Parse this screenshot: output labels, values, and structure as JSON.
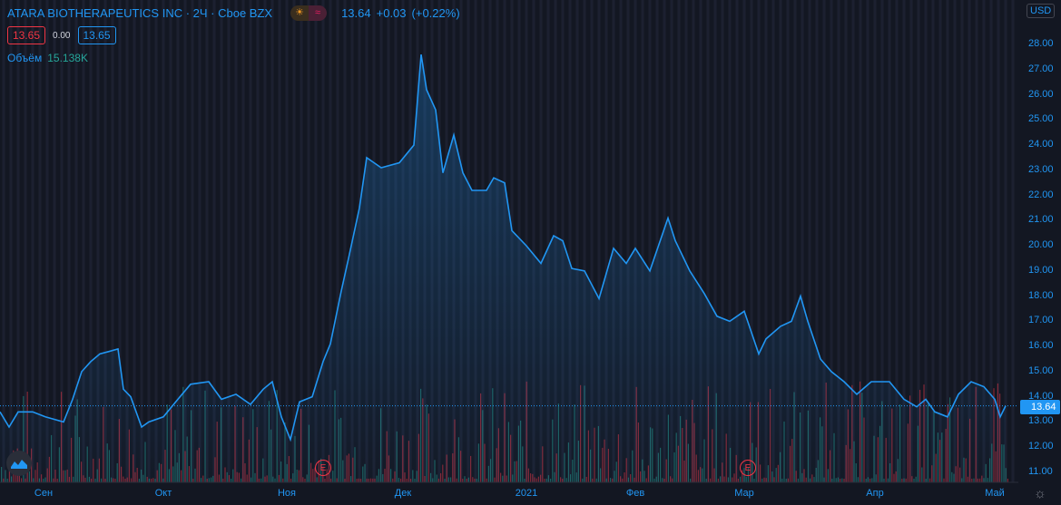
{
  "header": {
    "title": "ATARA BIOTHERAPEUTICS INC · 2Ч · Cboe BZX",
    "last": "13.64",
    "change": "+0.03",
    "change_pct": "(+0.22%)",
    "sun_icon": "sun-icon",
    "wave_icon": "wave-icon"
  },
  "quote": {
    "bid": "13.65",
    "spread": "0.00",
    "ask": "13.65"
  },
  "volume": {
    "label": "Объём",
    "value": "15.138K"
  },
  "currency": "USD",
  "colors": {
    "line": "#2196f3",
    "up": "#26a69a",
    "down": "#f23645",
    "bg": "#131722"
  },
  "earnings_label": "E",
  "chart_data": {
    "type": "area",
    "title": "ATARA BIOTHERAPEUTICS INC · 2Ч · Cboe BZX",
    "ylim": [
      10.5,
      29
    ],
    "y_ticks": [
      "28.00",
      "27.00",
      "26.00",
      "25.00",
      "24.00",
      "23.00",
      "22.00",
      "21.00",
      "20.00",
      "19.00",
      "18.00",
      "17.00",
      "16.00",
      "15.00",
      "14.00",
      "13.00",
      "12.00",
      "11.00"
    ],
    "x_ticks": [
      {
        "label": "Сен",
        "bar": 12
      },
      {
        "label": "Окт",
        "bar": 45
      },
      {
        "label": "Ноя",
        "bar": 79
      },
      {
        "label": "Дек",
        "bar": 111
      },
      {
        "label": "2021",
        "bar": 145
      },
      {
        "label": "Фев",
        "bar": 175
      },
      {
        "label": "Мар",
        "bar": 205
      },
      {
        "label": "Апр",
        "bar": 241
      },
      {
        "label": "Май",
        "bar": 274
      }
    ],
    "earnings_bars": [
      89,
      206
    ],
    "last_price": "13.64",
    "points": [
      [
        0,
        13.4
      ],
      [
        2.5,
        12.8
      ],
      [
        5,
        13.4
      ],
      [
        9,
        13.4
      ],
      [
        12.5,
        13.2
      ],
      [
        17.5,
        13.0
      ],
      [
        20,
        13.9
      ],
      [
        22.5,
        15.0
      ],
      [
        25,
        15.4
      ],
      [
        27.5,
        15.7
      ],
      [
        30,
        15.8
      ],
      [
        32.5,
        15.9
      ],
      [
        34,
        14.3
      ],
      [
        36,
        14.0
      ],
      [
        39,
        12.8
      ],
      [
        41,
        13.0
      ],
      [
        45,
        13.2
      ],
      [
        49,
        13.9
      ],
      [
        52.5,
        14.5
      ],
      [
        57.5,
        14.6
      ],
      [
        61,
        13.9
      ],
      [
        65,
        14.1
      ],
      [
        69,
        13.7
      ],
      [
        72.5,
        14.3
      ],
      [
        75,
        14.6
      ],
      [
        77.5,
        13.2
      ],
      [
        80,
        12.3
      ],
      [
        82.5,
        13.8
      ],
      [
        86,
        14.0
      ],
      [
        89,
        15.4
      ],
      [
        91,
        16.1
      ],
      [
        94,
        18.2
      ],
      [
        96,
        19.5
      ],
      [
        99,
        21.5
      ],
      [
        101,
        23.5
      ],
      [
        105,
        23.1
      ],
      [
        110,
        23.3
      ],
      [
        114,
        24.0
      ],
      [
        116,
        27.6
      ],
      [
        117.5,
        26.2
      ],
      [
        120,
        25.4
      ],
      [
        122,
        22.9
      ],
      [
        125,
        24.4
      ],
      [
        127.5,
        22.9
      ],
      [
        130,
        22.2
      ],
      [
        134,
        22.2
      ],
      [
        136,
        22.7
      ],
      [
        139,
        22.5
      ],
      [
        141,
        20.6
      ],
      [
        145,
        20.0
      ],
      [
        149,
        19.3
      ],
      [
        152.5,
        20.4
      ],
      [
        155,
        20.2
      ],
      [
        157.5,
        19.1
      ],
      [
        161,
        19.0
      ],
      [
        165,
        17.9
      ],
      [
        169,
        19.9
      ],
      [
        172.5,
        19.3
      ],
      [
        175,
        19.9
      ],
      [
        179,
        19.0
      ],
      [
        184,
        21.1
      ],
      [
        186,
        20.2
      ],
      [
        190,
        19.0
      ],
      [
        194,
        18.1
      ],
      [
        197.5,
        17.2
      ],
      [
        201,
        17.0
      ],
      [
        205,
        17.4
      ],
      [
        209,
        15.7
      ],
      [
        211,
        16.3
      ],
      [
        215,
        16.8
      ],
      [
        218,
        17.0
      ],
      [
        220.5,
        18.0
      ],
      [
        222.5,
        17.0
      ],
      [
        226,
        15.5
      ],
      [
        229,
        15.0
      ],
      [
        232.5,
        14.6
      ],
      [
        236,
        14.1
      ],
      [
        240,
        14.6
      ],
      [
        245,
        14.6
      ],
      [
        249,
        13.9
      ],
      [
        252.5,
        13.6
      ],
      [
        255,
        13.9
      ],
      [
        257.5,
        13.4
      ],
      [
        261,
        13.2
      ],
      [
        264,
        14.1
      ],
      [
        267.5,
        14.6
      ],
      [
        271,
        14.4
      ],
      [
        274,
        13.9
      ],
      [
        275.5,
        13.2
      ],
      [
        277,
        13.64
      ]
    ]
  }
}
